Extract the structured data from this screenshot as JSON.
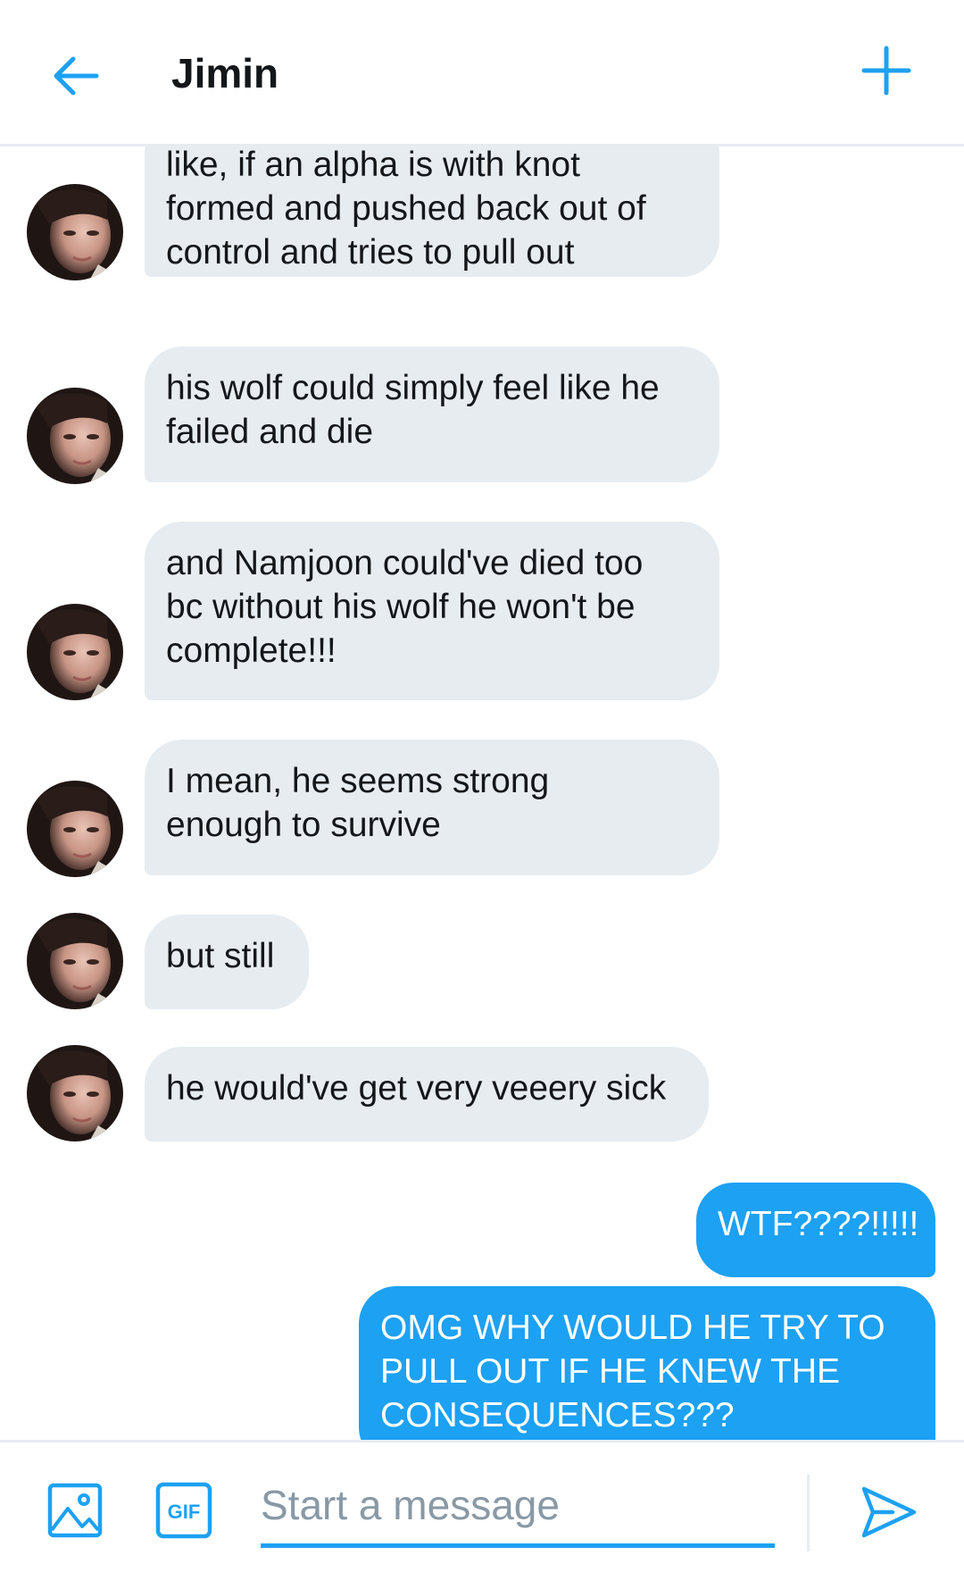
{
  "header": {
    "title": "Jimin",
    "back_icon": "arrow-left-icon",
    "action_icon": "plus-icon"
  },
  "colors": {
    "accent": "#1da1f2",
    "incoming_bubble": "#e6ecf0",
    "text": "#14171a",
    "placeholder": "#8899a6"
  },
  "messages": [
    {
      "direction": "incoming",
      "text": "like, if an alpha is with knot\nformed and pushed back out of\ncontrol and tries to pull out"
    },
    {
      "direction": "incoming",
      "text": "his wolf could simply feel like he\nfailed and die"
    },
    {
      "direction": "incoming",
      "text": "and Namjoon could've died too\nbc without his wolf he won't be\ncomplete!!!"
    },
    {
      "direction": "incoming",
      "text": "I mean, he seems strong\nenough to survive"
    },
    {
      "direction": "incoming",
      "text": "but still"
    },
    {
      "direction": "incoming",
      "text": "he would've get very veeery sick"
    },
    {
      "direction": "outgoing",
      "text": "WTF????!!!!!"
    },
    {
      "direction": "outgoing",
      "text": "OMG WHY WOULD HE TRY TO\nPULL OUT IF HE KNEW THE\nCONSEQUENCES???"
    }
  ],
  "composer": {
    "placeholder": "Start a message",
    "value": "",
    "media_icon": "image-icon",
    "gif_icon": "gif-icon",
    "gif_label": "GIF",
    "send_icon": "send-icon"
  }
}
